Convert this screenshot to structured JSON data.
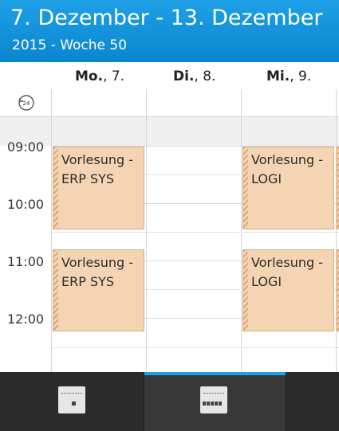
{
  "header": {
    "title": "7. Dezember - 13. Dezember",
    "subtitle": "2015 - Woche 50"
  },
  "days": [
    {
      "name": "Mo.",
      "num": ", 7."
    },
    {
      "name": "Di.",
      "num": ", 8."
    },
    {
      "name": "Mi.",
      "num": ", 9."
    }
  ],
  "allday": {
    "icon": "clock-24-icon"
  },
  "times": [
    "09:00",
    "10:00",
    "11:00",
    "12:00"
  ],
  "events": {
    "mon1": {
      "line1": "Vorlesung -",
      "line2": "ERP SYS"
    },
    "mon2": {
      "line1": "Vorlesung -",
      "line2": "ERP SYS"
    },
    "wed1": {
      "line1": "Vorlesung -",
      "line2": "LOGI"
    },
    "wed2": {
      "line1": "Vorlesung -",
      "line2": "LOGI"
    }
  },
  "tabs": [
    {
      "name": "day-view",
      "icon": "calendar-day-icon",
      "selected": false
    },
    {
      "name": "week-view",
      "icon": "calendar-week-icon",
      "selected": true
    }
  ],
  "colors": {
    "accent": "#1ea0e6",
    "event_bg": "#f4d4b2"
  }
}
